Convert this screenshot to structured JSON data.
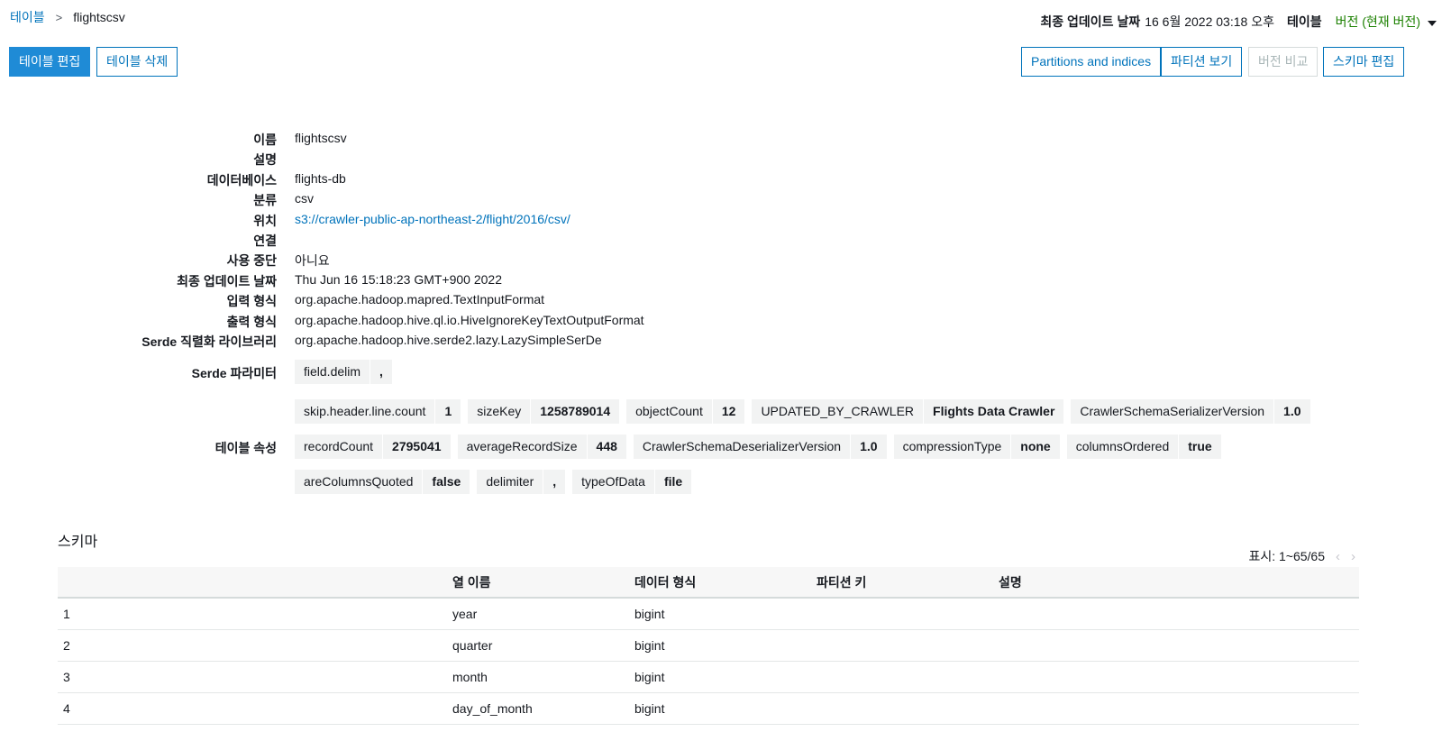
{
  "breadcrumb": {
    "parent": "테이블",
    "current": "flightscsv"
  },
  "header": {
    "last_updated_label": "최종 업데이트 날짜",
    "last_updated_value": "16 6월 2022 03:18 오후",
    "table_label": "테이블",
    "version_label": "버전 (현재 버전)"
  },
  "actions": {
    "edit_table": "테이블 편집",
    "delete_table": "테이블 삭제",
    "partitions_indices": "Partitions and indices",
    "view_partitions": "파티션 보기",
    "compare_versions": "버전 비교",
    "edit_schema": "스키마 편집"
  },
  "details": [
    {
      "key": "이름",
      "value": "flightscsv"
    },
    {
      "key": "설명",
      "value": ""
    },
    {
      "key": "데이터베이스",
      "value": "flights-db"
    },
    {
      "key": "분류",
      "value": "csv"
    },
    {
      "key": "위치",
      "value": "s3://crawler-public-ap-northeast-2/flight/2016/csv/"
    },
    {
      "key": "연결",
      "value": ""
    },
    {
      "key": "사용 중단",
      "value": "아니요"
    },
    {
      "key": "최종 업데이트 날짜",
      "value": "Thu Jun 16 15:18:23 GMT+900 2022"
    },
    {
      "key": "입력 형식",
      "value": "org.apache.hadoop.mapred.TextInputFormat"
    },
    {
      "key": "출력 형식",
      "value": "org.apache.hadoop.hive.ql.io.HiveIgnoreKeyTextOutputFormat"
    },
    {
      "key": "Serde 직렬화 라이브러리",
      "value": "org.apache.hadoop.hive.serde2.lazy.LazySimpleSerDe"
    }
  ],
  "serde": {
    "label": "Serde 파라미터",
    "params": [
      {
        "k": "field.delim",
        "v": ","
      }
    ]
  },
  "table_properties": {
    "label": "테이블 속성",
    "lines": [
      [
        {
          "k": "skip.header.line.count",
          "v": "1"
        },
        {
          "k": "sizeKey",
          "v": "1258789014"
        },
        {
          "k": "objectCount",
          "v": "12"
        },
        {
          "k": "UPDATED_BY_CRAWLER",
          "v": "Flights Data Crawler"
        },
        {
          "k": "CrawlerSchemaSerializerVersion",
          "v": "1.0"
        }
      ],
      [
        {
          "k": "recordCount",
          "v": "2795041"
        },
        {
          "k": "averageRecordSize",
          "v": "448"
        },
        {
          "k": "CrawlerSchemaDeserializerVersion",
          "v": "1.0"
        },
        {
          "k": "compressionType",
          "v": "none"
        },
        {
          "k": "columnsOrdered",
          "v": "true"
        }
      ],
      [
        {
          "k": "areColumnsQuoted",
          "v": "false"
        },
        {
          "k": "delimiter",
          "v": ","
        },
        {
          "k": "typeOfData",
          "v": "file"
        }
      ]
    ]
  },
  "schema": {
    "title": "스키마",
    "pager": "표시: 1~65/65",
    "columns": [
      "",
      "열 이름",
      "데이터 형식",
      "파티션 키",
      "설명"
    ],
    "rows": [
      [
        "1",
        "year",
        "bigint",
        "",
        ""
      ],
      [
        "2",
        "quarter",
        "bigint",
        "",
        ""
      ],
      [
        "3",
        "month",
        "bigint",
        "",
        ""
      ],
      [
        "4",
        "day_of_month",
        "bigint",
        "",
        ""
      ]
    ]
  }
}
